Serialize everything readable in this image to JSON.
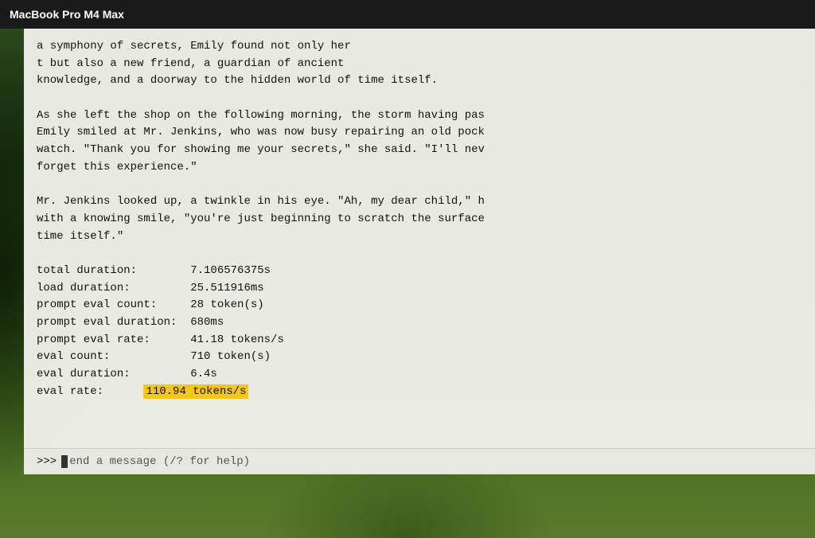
{
  "titlebar": {
    "title": "MacBook Pro M4 Max"
  },
  "terminal": {
    "lines": [
      "a symphony of secrets, Emily found not only her",
      "t but also a new friend, a guardian of ancient",
      "knowledge, and a doorway to the hidden world of time itself.",
      "",
      "As she left the shop on the following morning, the storm having pas",
      "Emily smiled at Mr. Jenkins, who was now busy repairing an old pock",
      "watch. \"Thank you for showing me your secrets,\" she said. \"I'll nev",
      "forget this experience.\"",
      "",
      "Mr. Jenkins looked up, a twinkle in his eye. \"Ah, my dear child,\" h",
      "with a knowing smile, \"you're just beginning to scratch the surface",
      "time itself.\"",
      "",
      "total duration:        7.106576375s",
      "load duration:         25.511916ms",
      "prompt eval count:     28 token(s)",
      "prompt eval duration:  680ms",
      "prompt eval rate:      41.18 tokens/s",
      "eval count:            710 token(s)",
      "eval duration:         6.4s"
    ],
    "eval_rate_label": "eval rate:",
    "eval_rate_value": "110.94 tokens/s",
    "input": {
      "prompt": ">>>",
      "placeholder": "end a message (/? for help)"
    }
  }
}
